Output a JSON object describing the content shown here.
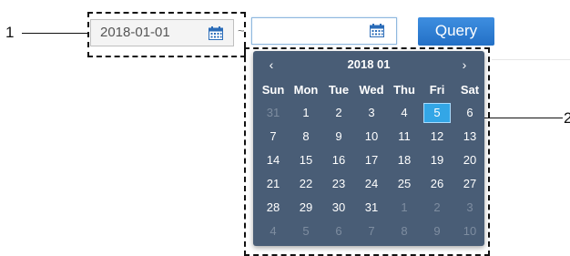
{
  "callouts": {
    "one": "1",
    "two": "2"
  },
  "filter": {
    "start_date": "2018-01-01",
    "separator": "~",
    "end_date": "",
    "query_label": "Query"
  },
  "calendar": {
    "prev": "‹",
    "next": "›",
    "title": "2018 01",
    "weekdays": [
      "Sun",
      "Mon",
      "Tue",
      "Wed",
      "Thu",
      "Fri",
      "Sat"
    ],
    "weeks": [
      [
        "31",
        "1",
        "2",
        "3",
        "4",
        "5",
        "6"
      ],
      [
        "7",
        "8",
        "9",
        "10",
        "11",
        "12",
        "13"
      ],
      [
        "14",
        "15",
        "16",
        "17",
        "18",
        "19",
        "20"
      ],
      [
        "21",
        "22",
        "23",
        "24",
        "25",
        "26",
        "27"
      ],
      [
        "28",
        "29",
        "30",
        "31",
        "1",
        "2",
        "3"
      ],
      [
        "4",
        "5",
        "6",
        "7",
        "8",
        "9",
        "10"
      ]
    ],
    "muted_cells": [
      "0-0",
      "4-4",
      "4-5",
      "4-6",
      "5-0",
      "5-1",
      "5-2",
      "5-3",
      "5-4",
      "5-5",
      "5-6"
    ],
    "selected_cell": "0-5",
    "colors": {
      "panel": "#495d76",
      "selected": "#33a6e6",
      "button": "#2a78cc"
    }
  },
  "icons": {
    "calendar": "calendar-icon"
  }
}
